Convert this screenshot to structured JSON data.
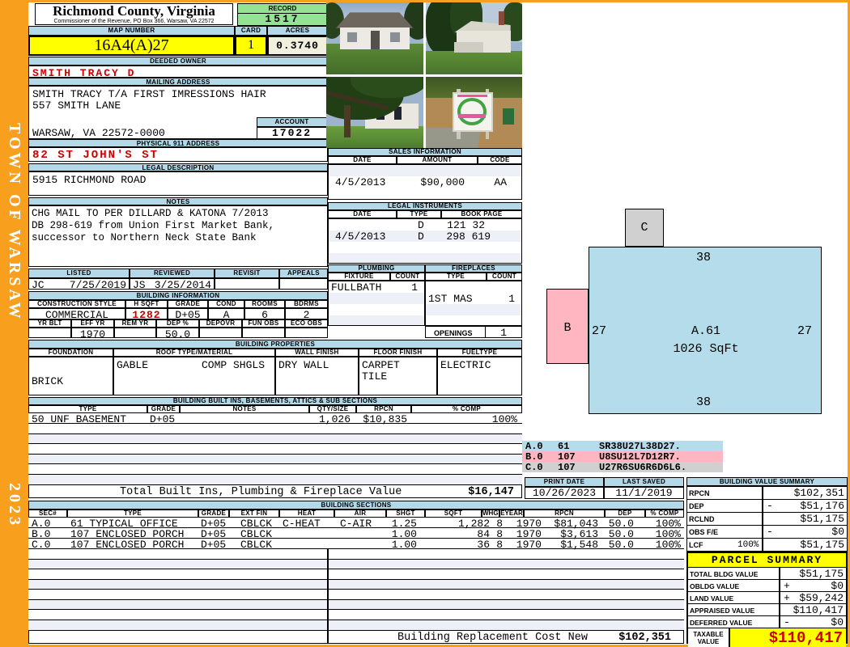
{
  "sidebar": {
    "town": "TOWN OF WARSAW",
    "year": "2023"
  },
  "header": {
    "county_title": "Richmond County, Virginia",
    "county_subtitle": "Commissioner of the Revenue, PO Box 366, Warsaw, VA 22572",
    "record_label": "RECORD",
    "record_value": "1517",
    "map_label": "MAP NUMBER",
    "map_value": "16A4(A)27",
    "card_label": "CARD",
    "card_value": "1",
    "acres_label": "ACRES",
    "acres_value": "0.3740"
  },
  "owner": {
    "deeded_label": "DEEDED OWNER",
    "deeded_value": "SMITH TRACY D",
    "mailing_label": "MAILING ADDRESS",
    "mailing_line1": "SMITH TRACY T/A FIRST IMRESSIONS HAIR",
    "mailing_line2": "557 SMITH LANE",
    "mailing_line3": "WARSAW, VA 22572-0000",
    "account_label": "ACCOUNT",
    "account_value": "17022",
    "physical_label": "PHYSICAL 911 ADDRESS",
    "physical_value": "82 ST JOHN'S ST",
    "legal_label": "LEGAL DESCRIPTION",
    "legal_value": "5915 RICHMOND ROAD"
  },
  "notes": {
    "label": "NOTES",
    "line1": "CHG MAIL TO PER DILLARD & KATONA 7/2013",
    "line2": "DB 298-619 from Union First Market Bank,",
    "line3": "successor to Northern Neck State Bank"
  },
  "review": {
    "listed_label": "LISTED",
    "reviewed_label": "REVIEWED",
    "revisit_label": "REVISIT",
    "appeals_label": "APPEALS",
    "listed_by": "JC",
    "listed_date": "7/25/2019",
    "reviewed_by": "JS",
    "reviewed_date": "3/25/2014"
  },
  "building_info": {
    "title": "BUILDING INFORMATION",
    "h1": {
      "style": "CONSTRUCTION STYLE",
      "hsqft": "H SQFT",
      "grade": "GRADE",
      "cond": "COND",
      "rooms": "ROOMS",
      "bdrms": "BDRMS"
    },
    "v1": {
      "style": "COMMERCIAL",
      "hsqft": "1282",
      "grade": "D+05",
      "cond": "A",
      "rooms": "6",
      "bdrms": "2"
    },
    "h2": {
      "yrblt": "YR BLT",
      "effyr": "EFF YR",
      "remyr": "REM YR",
      "dep": "DEP %",
      "depovr": "DEPOVR",
      "funobs": "FUN OBS",
      "ecoobs": "ECO OBS"
    },
    "v2": {
      "effyr": "1970",
      "dep": "50.0"
    }
  },
  "building_properties": {
    "title": "BUILDING PROPERTIES",
    "headers": {
      "foundation": "FOUNDATION",
      "roof": "ROOF TYPE/MATERIAL",
      "wall": "WALL FINISH",
      "floor": "FLOOR FINISH",
      "fuel": "FUELTYPE"
    },
    "values": {
      "foundation": "BRICK",
      "roof_type": "GABLE",
      "roof_material": "COMP SHGLS",
      "wall": "DRY WALL",
      "floor_line1": "CARPET",
      "floor_line2": "TILE",
      "fuel": "ELECTRIC"
    }
  },
  "built_ins": {
    "title": "BUILDING BUILT INS, BASEMENTS, ATTICS & SUB SECTIONS",
    "headers": {
      "type": "TYPE",
      "grade": "GRADE",
      "notes": "NOTES",
      "qty": "QTY/SIZE",
      "rpcn": "RPCN",
      "comp": "% COMP"
    },
    "row": {
      "type": "50 UNF BASEMENT",
      "grade": "D+05",
      "qty": "1,026",
      "rpcn": "$10,835",
      "comp": "100%"
    },
    "total_label": "Total Built Ins, Plumbing & Fireplace Value",
    "total_value": "$16,147"
  },
  "sales": {
    "title": "SALES INFORMATION",
    "headers": {
      "date": "DATE",
      "amount": "AMOUNT",
      "code": "CODE"
    },
    "row": {
      "date": "4/5/2013",
      "amount": "$90,000",
      "code": "AA"
    }
  },
  "legal_instruments": {
    "title": "LEGAL INSTRUMENTS",
    "headers": {
      "date": "DATE",
      "type": "TYPE",
      "book": "BOOK PAGE"
    },
    "rows": [
      {
        "date": "",
        "type": "D",
        "book": "121 32"
      },
      {
        "date": "4/5/2013",
        "type": "D",
        "book": "298 619"
      }
    ]
  },
  "plumbing": {
    "title": "PLUMBING",
    "fixture_label": "FIXTURE",
    "count_label": "COUNT",
    "row": {
      "fixture": "FULLBATH",
      "count": "1"
    }
  },
  "fireplaces": {
    "title": "FIREPLACES",
    "type_label": "TYPE",
    "count_label": "COUNT",
    "row": {
      "type": "1ST MAS",
      "count": "1"
    },
    "openings_label": "OPENINGS",
    "openings_value": "1"
  },
  "sketch": {
    "a_label": "A.61",
    "a_sqft": "1026 SqFt",
    "b_label": "B",
    "c_label": "C",
    "dim_top": "38",
    "dim_bottom": "38",
    "dim_left": "27",
    "dim_right": "27",
    "legend": [
      {
        "code": "A.0",
        "num": "61",
        "vector": "SR38U27L38D27."
      },
      {
        "code": "B.0",
        "num": "107",
        "vector": "U8SU12L7D12R7."
      },
      {
        "code": "C.0",
        "num": "107",
        "vector": "U27R6SU6R6D6L6."
      }
    ]
  },
  "print_info": {
    "print_label": "PRINT DATE",
    "print_value": "10/26/2023",
    "saved_label": "LAST SAVED",
    "saved_value": "11/1/2019"
  },
  "value_summary": {
    "title": "BUILDING VALUE SUMMARY",
    "rows": [
      {
        "label": "RPCN",
        "extra": "",
        "op": "",
        "amount": "$102,351"
      },
      {
        "label": "DEP",
        "extra": "",
        "op": "-",
        "amount": "$51,176"
      },
      {
        "label": "RCLND",
        "extra": "",
        "op": "",
        "amount": "$51,175"
      },
      {
        "label": "OBS F/E",
        "extra": "",
        "op": "-",
        "amount": "$0"
      },
      {
        "label": "LCF",
        "extra": "100%",
        "op": "",
        "amount": "$51,175"
      }
    ]
  },
  "building_sections": {
    "title": "BUILDING SECTIONS",
    "headers": {
      "sec": "SEC#",
      "type": "TYPE",
      "grade": "GRADE",
      "extfin": "EXT FIN",
      "heat": "HEAT",
      "air": "AIR",
      "shgt": "SHGT",
      "sqft": "SQFT",
      "whgt": "WHGT",
      "eyear": "EYEAR",
      "rpcn": "RPCN",
      "dep": "DEP",
      "comp": "% COMP"
    },
    "rows": [
      {
        "sec": "A.0",
        "type": "61 TYPICAL OFFICE",
        "grade": "D+05",
        "extfin": "CBLCK",
        "heat": "C-HEAT",
        "air": "C-AIR",
        "shgt": "1.25",
        "sqft": "1,282",
        "whgt": "8",
        "eyear": "1970",
        "rpcn": "$81,043",
        "dep": "50.0",
        "comp": "100%"
      },
      {
        "sec": "B.0",
        "type": "107 ENCLOSED PORCH",
        "grade": "D+05",
        "extfin": "CBLCK",
        "heat": "",
        "air": "",
        "shgt": "1.00",
        "sqft": "84",
        "whgt": "8",
        "eyear": "1970",
        "rpcn": "$3,613",
        "dep": "50.0",
        "comp": "100%"
      },
      {
        "sec": "C.0",
        "type": "107 ENCLOSED PORCH",
        "grade": "D+05",
        "extfin": "CBLCK",
        "heat": "",
        "air": "",
        "shgt": "1.00",
        "sqft": "36",
        "whgt": "8",
        "eyear": "1970",
        "rpcn": "$1,548",
        "dep": "50.0",
        "comp": "100%"
      }
    ],
    "replacement_label": "Building Replacement Cost New",
    "replacement_value": "$102,351"
  },
  "parcel_summary": {
    "title": "PARCEL SUMMARY",
    "rows": [
      {
        "label": "TOTAL BLDG VALUE",
        "op": "",
        "amount": "$51,175"
      },
      {
        "label": "OBLDG VALUE",
        "op": "+",
        "amount": "$0"
      },
      {
        "label": "LAND VALUE",
        "op": "+",
        "amount": "$59,242"
      },
      {
        "label": "APPRAISED VALUE",
        "op": "",
        "amount": "$110,417"
      },
      {
        "label": "DEFERRED VALUE",
        "op": "-",
        "amount": "$0"
      }
    ],
    "taxable_label": "TAXABLE VALUE",
    "taxable_value": "$110,417"
  },
  "photos": {
    "p1": "house-front-view",
    "p2": "house-side-view",
    "p3": "house-under-tree-view",
    "p4": "business-sign-view"
  },
  "colors": {
    "frame_orange": "#f8a01d",
    "header_blue": "#b3d9e8",
    "record_green": "#94e294",
    "highlight_yellow": "#ffff00",
    "acres_cream": "#f2efdf",
    "alert_red": "#cc0000",
    "sketch_a_blue": "#b4dcea",
    "sketch_b_pink": "#ffb6c1",
    "sketch_c_gray": "#d0d0d0"
  }
}
